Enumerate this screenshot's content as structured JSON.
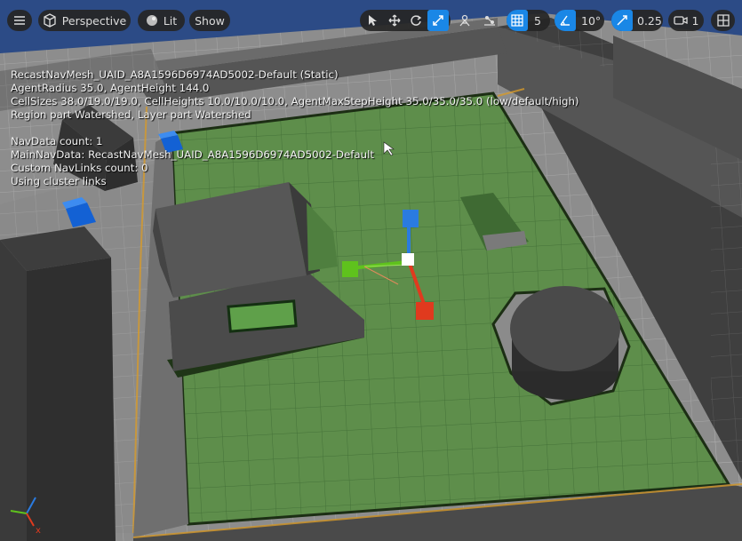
{
  "toolbar": {
    "view_mode_label": "Perspective",
    "lighting_label": "Lit",
    "show_label": "Show",
    "grid_snap_value": "5",
    "rotation_snap_value": "10°",
    "scale_snap_value": "0.25",
    "camera_speed_value": "1"
  },
  "stats": {
    "navmesh_name": "RecastNavMesh_UAID_A8A1596D6974AD5002-Default (Static)",
    "agent_line": "AgentRadius 35.0, AgentHeight 144.0",
    "cell_line": "CellSizes 38.0/19.0/19.0, CellHeights 10.0/10.0/10.0, AgentMaxStepHeight 35.0/35.0/35.0 (low/default/high)",
    "region_line": "Region part Watershed, Layer part Watershed",
    "navdata_count": "NavData count: 1",
    "main_navdata": "MainNavData: RecastNavMesh_UAID_A8A1596D6974AD5002-Default",
    "custom_navlinks": "Custom NavLinks count: 0",
    "cluster_links": "Using cluster links"
  },
  "colors": {
    "sky": "#2f4f8c",
    "floor": "#8a8a8a",
    "navmesh": "#5c8f46",
    "wall": "#4a4a4a",
    "accent": "#1a87e6",
    "gizmo_x": "#e03a1e",
    "gizmo_y": "#5fc21d",
    "gizmo_z": "#2a7be0"
  }
}
